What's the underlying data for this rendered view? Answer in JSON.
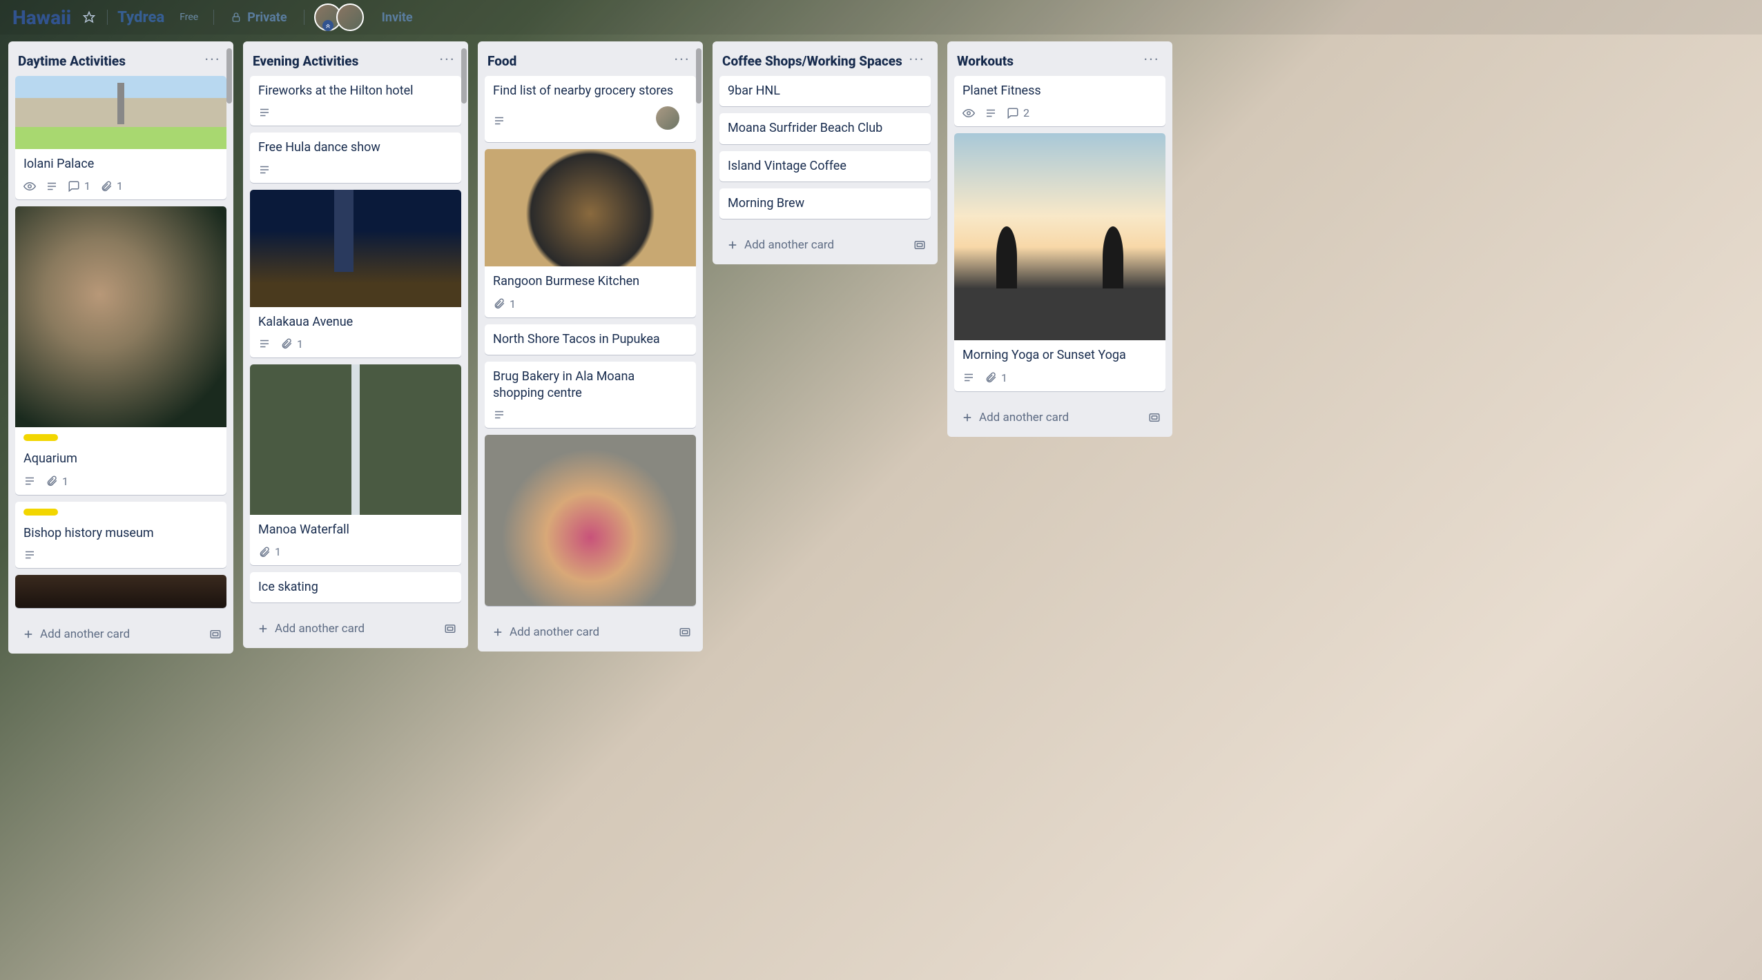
{
  "header": {
    "board_name": "Hawaii",
    "team_name": "Tydrea",
    "free_label": "Free",
    "privacy_label": "Private",
    "invite_label": "Invite"
  },
  "add_card_label": "Add another card",
  "lists": [
    {
      "title": "Daytime Activities",
      "cards": [
        {
          "title": "Iolani Palace",
          "cover": "cov-palace",
          "watch": true,
          "desc": true,
          "comments": 1,
          "attachments": 1,
          "label": null
        },
        {
          "title": "Aquarium",
          "cover": "cov-octopus",
          "desc": true,
          "attachments": 1,
          "label": "yellow"
        },
        {
          "title": "Bishop history museum",
          "cover": null,
          "desc": true,
          "label": "yellow"
        },
        {
          "title": "",
          "cover": "cov-dark"
        }
      ]
    },
    {
      "title": "Evening Activities",
      "cards": [
        {
          "title": "Fireworks at the Hilton hotel",
          "desc": true
        },
        {
          "title": "Free Hula dance show",
          "desc": true
        },
        {
          "title": "Kalakaua Avenue",
          "cover": "cov-hotel",
          "desc": true,
          "attachments": 1
        },
        {
          "title": "Manoa Waterfall",
          "cover": "cov-waterfall",
          "attachments": 1
        },
        {
          "title": "Ice skating"
        }
      ]
    },
    {
      "title": "Food",
      "cards": [
        {
          "title": "Find list of nearby grocery stores",
          "desc": true,
          "member": true
        },
        {
          "title": "Rangoon Burmese Kitchen",
          "cover": "cov-food",
          "attachments": 1
        },
        {
          "title": "North Shore Tacos in Pupukea"
        },
        {
          "title": "Brug Bakery in Ala Moana shopping centre",
          "desc": true
        },
        {
          "title": "",
          "cover": "cov-shaka"
        }
      ]
    },
    {
      "title": "Coffee Shops/Working Spaces",
      "cards": [
        {
          "title": "9bar HNL"
        },
        {
          "title": "Moana Surfrider Beach Club"
        },
        {
          "title": "Island Vintage Coffee"
        },
        {
          "title": "Morning Brew"
        }
      ]
    },
    {
      "title": "Workouts",
      "cards": [
        {
          "title": "Planet Fitness",
          "watch": true,
          "desc": true,
          "comments": 2
        },
        {
          "title": "Morning Yoga or Sunset Yoga",
          "cover": "cov-yoga",
          "desc": true,
          "attachments": 1
        }
      ]
    }
  ]
}
